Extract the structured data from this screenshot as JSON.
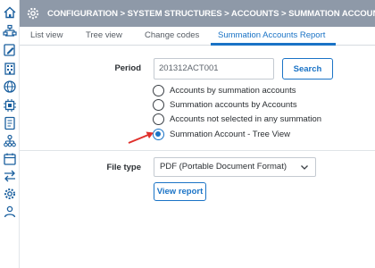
{
  "header": {
    "breadcrumb": "CONFIGURATION > SYSTEM STRUCTURES > ACCOUNTS > SUMMATION ACCOUNTS",
    "icon": "gear-icon"
  },
  "sidebar": {
    "icons": [
      "home-icon",
      "hierarchy-icon",
      "document-edit-icon",
      "building-icon",
      "globe-icon",
      "chip-icon",
      "ledger-icon",
      "org-chart-icon",
      "calendar-icon",
      "transfer-arrows-icon",
      "settings-gear-icon",
      "users-icon"
    ]
  },
  "tabs": [
    {
      "label": "List view",
      "active": false
    },
    {
      "label": "Tree view",
      "active": false
    },
    {
      "label": "Change codes",
      "active": false
    },
    {
      "label": "Summation Accounts Report",
      "active": true
    }
  ],
  "form": {
    "period_label": "Period",
    "period_value": "201312ACT001",
    "search_label": "Search",
    "options": [
      {
        "label": "Accounts by summation accounts",
        "checked": false
      },
      {
        "label": "Summation accounts by Accounts",
        "checked": false
      },
      {
        "label": "Accounts not selected in any summation",
        "checked": false
      },
      {
        "label": "Summation Account - Tree View",
        "checked": true
      }
    ],
    "file_type_label": "File type",
    "file_type_value": "PDF (Portable Document Format)",
    "view_report_label": "View report"
  },
  "colors": {
    "header_bg": "#8e99a8",
    "accent": "#1a73c6",
    "arrow": "#e0302b"
  }
}
